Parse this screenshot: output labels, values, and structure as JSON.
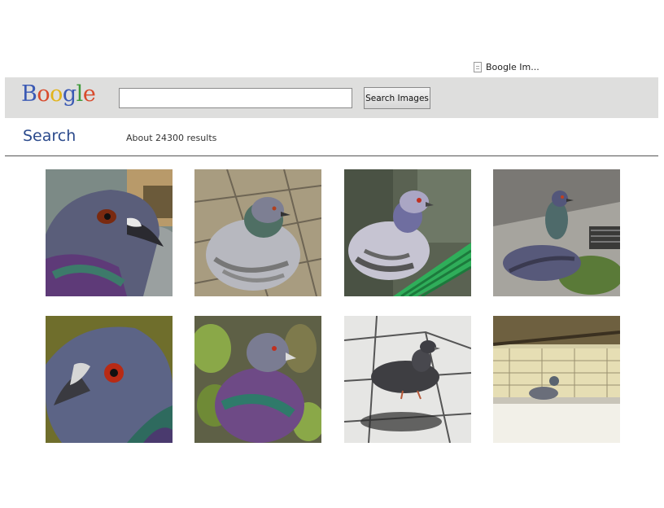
{
  "tab": {
    "label": "Boogle Im...",
    "icon": "page-icon"
  },
  "header": {
    "logo_letters": [
      {
        "ch": "B",
        "color": "#3b5ab4"
      },
      {
        "ch": "o",
        "color": "#d84a2c"
      },
      {
        "ch": "o",
        "color": "#e2b41a"
      },
      {
        "ch": "g",
        "color": "#3b5ab4"
      },
      {
        "ch": "l",
        "color": "#3f9a3a"
      },
      {
        "ch": "e",
        "color": "#d84a2c"
      }
    ],
    "search_value": "",
    "search_placeholder": "",
    "search_button": "Search Images"
  },
  "page_title": "Search",
  "results_text": "About 24300 results",
  "images": [
    {
      "name": "pigeon-head-closeup-rocks"
    },
    {
      "name": "pigeon-on-pavement"
    },
    {
      "name": "pigeon-on-green-fence"
    },
    {
      "name": "pigeon-on-curb-grate"
    },
    {
      "name": "pigeon-head-profile"
    },
    {
      "name": "pigeon-among-leaves"
    },
    {
      "name": "pigeon-on-tiles-shadow"
    },
    {
      "name": "pigeon-on-balcony-ledge"
    }
  ]
}
